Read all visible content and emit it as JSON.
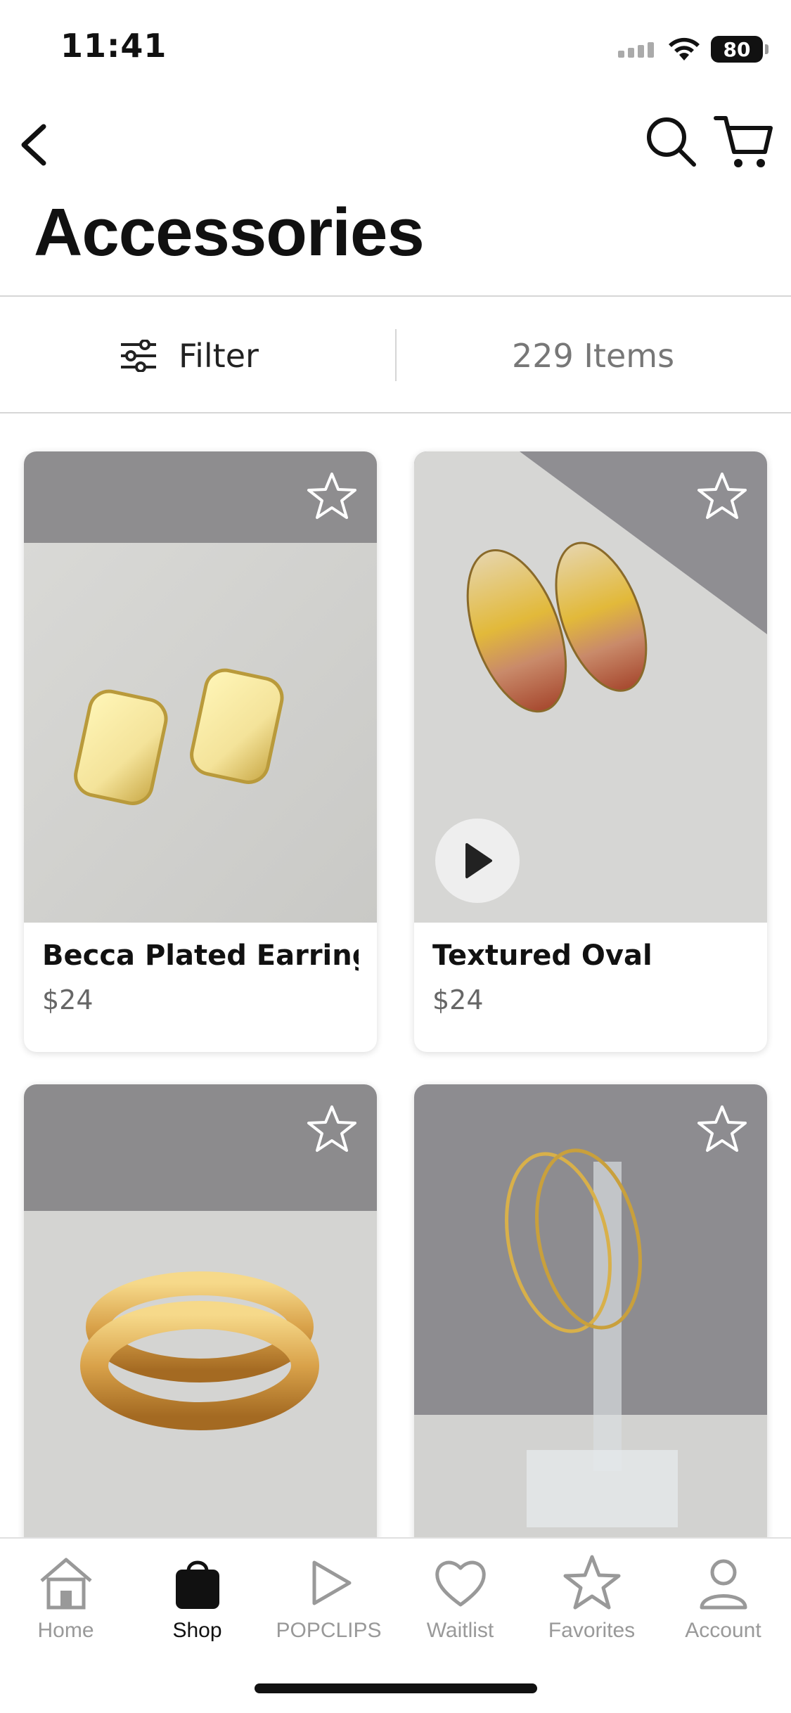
{
  "status_bar": {
    "time": "11:41",
    "battery": "80"
  },
  "header": {
    "title": "Accessories"
  },
  "filter_bar": {
    "filter_label": "Filter",
    "items_count": "229 Items"
  },
  "products": [
    {
      "name": "Becca Plated Earrings-",
      "price": "$24",
      "has_video": false
    },
    {
      "name": "Textured Oval",
      "price": "$24",
      "has_video": true
    },
    {
      "name": "",
      "price": "",
      "has_video": false
    },
    {
      "name": "",
      "price": "",
      "has_video": false
    }
  ],
  "tab_bar": {
    "tabs": [
      {
        "label": "Home",
        "icon": "home-icon",
        "active": false
      },
      {
        "label": "Shop",
        "icon": "shopping-bag-icon",
        "active": true
      },
      {
        "label": "POPCLIPS",
        "icon": "play-icon",
        "active": false
      },
      {
        "label": "Waitlist",
        "icon": "heart-icon",
        "active": false
      },
      {
        "label": "Favorites",
        "icon": "star-icon",
        "active": false
      },
      {
        "label": "Account",
        "icon": "person-icon",
        "active": false
      }
    ]
  },
  "colors": {
    "accent": "#111111",
    "inactive": "#999999",
    "price": "#666666"
  }
}
